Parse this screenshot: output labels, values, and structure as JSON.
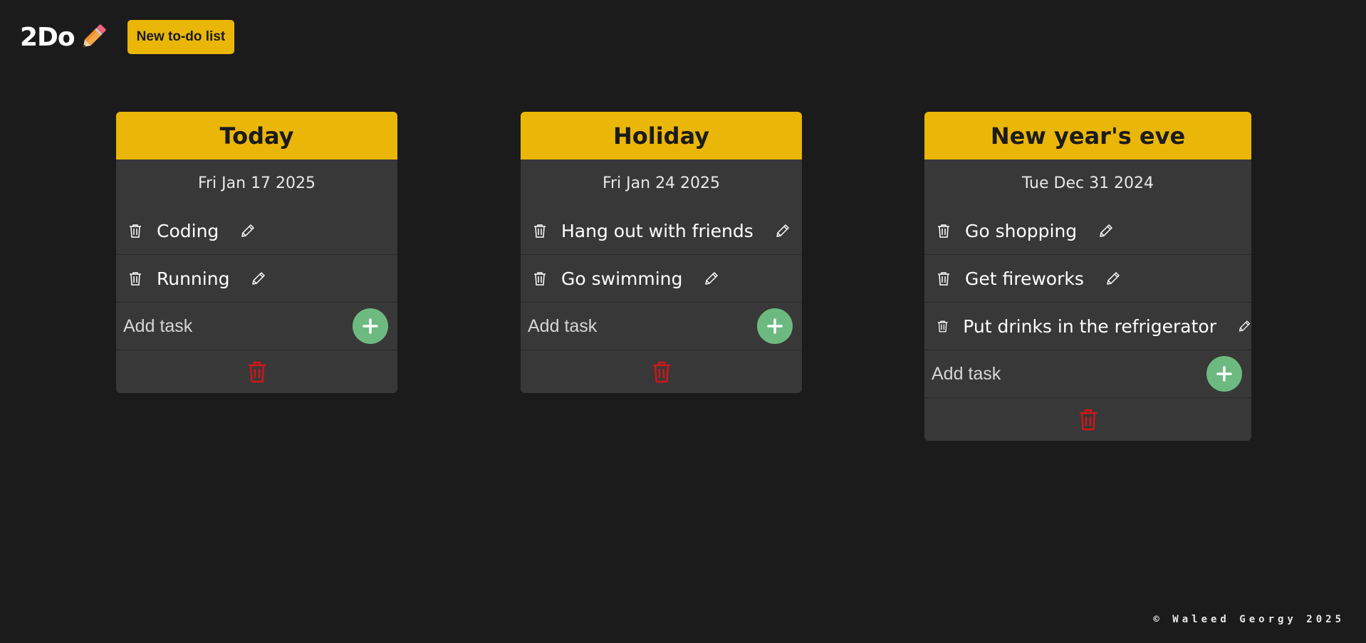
{
  "app": {
    "logo_text": "2Do",
    "logo_icon": "pencil-icon",
    "new_list_label": "New to-do list"
  },
  "lists": [
    {
      "title": "Today",
      "date": "Fri Jan 17 2025",
      "tasks": [
        "Coding",
        "Running"
      ],
      "add_placeholder": "Add task"
    },
    {
      "title": "Holiday",
      "date": "Fri Jan 24 2025",
      "tasks": [
        "Hang out with friends",
        "Go swimming"
      ],
      "add_placeholder": "Add task"
    },
    {
      "title": "New year's eve",
      "date": "Tue Dec 31 2024",
      "tasks": [
        "Go shopping",
        "Get fireworks",
        "Put drinks in the refrigerator"
      ],
      "add_placeholder": "Add task"
    }
  ],
  "footer": {
    "text": "© Waleed Georgy 2025"
  },
  "colors": {
    "background": "#1b1b1b",
    "accent": "#eab607",
    "card": "#383838",
    "add_button": "#6dba80",
    "delete_list": "#d0161a"
  }
}
